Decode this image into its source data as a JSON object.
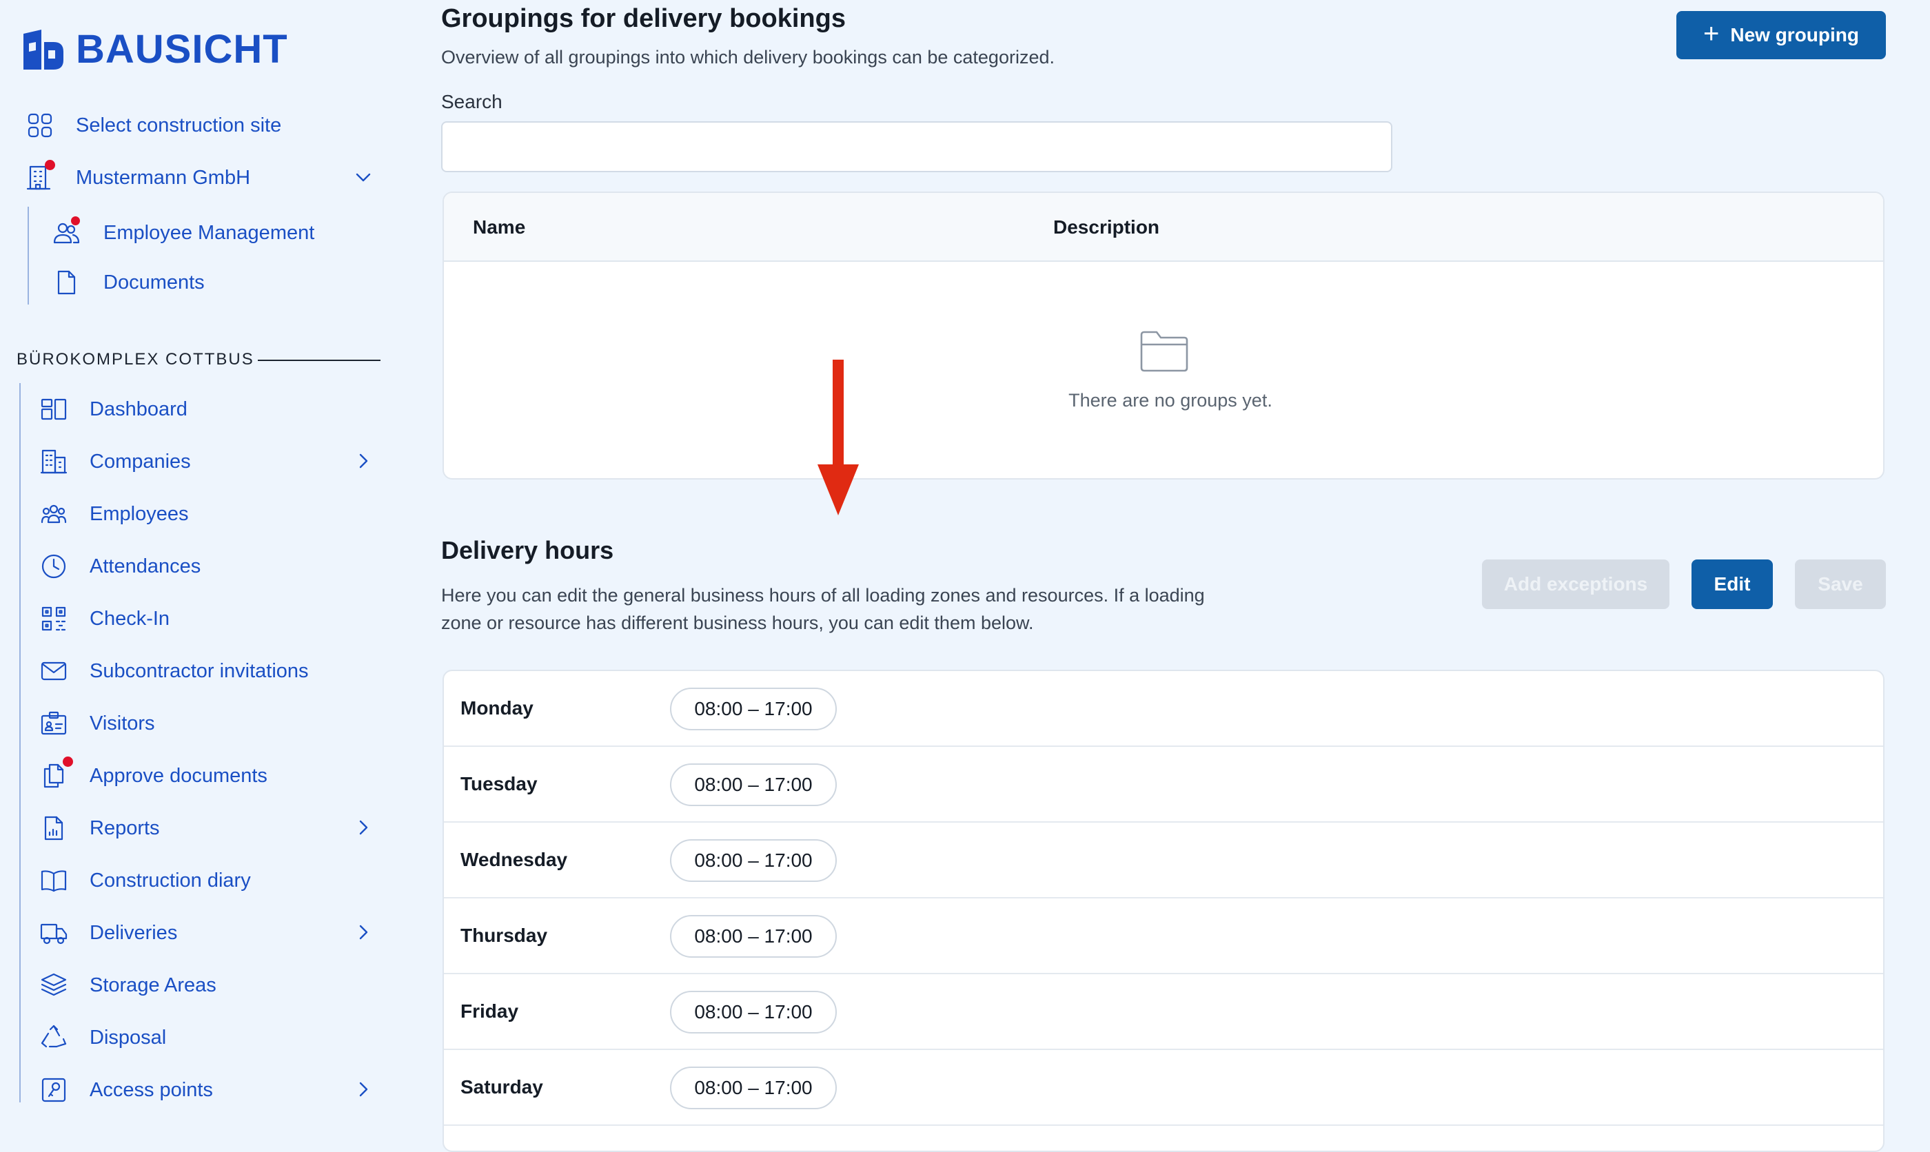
{
  "brand": {
    "name": "BAUSICHT"
  },
  "sidebar": {
    "top_items": [
      {
        "label": "Select construction site",
        "icon": "grid-icon"
      },
      {
        "label": "Mustermann GmbH",
        "icon": "building-icon"
      }
    ],
    "company_items": [
      {
        "label": "Employee Management",
        "icon": "users-icon"
      },
      {
        "label": "Documents",
        "icon": "document-icon"
      }
    ],
    "section_title": "BÜROKOMPLEX COTTBUS",
    "items": [
      {
        "label": "Dashboard",
        "icon": "dashboard-icon"
      },
      {
        "label": "Companies",
        "icon": "building-icon"
      },
      {
        "label": "Employees",
        "icon": "employees-icon"
      },
      {
        "label": "Attendances",
        "icon": "clock-icon"
      },
      {
        "label": "Check-In",
        "icon": "qr-code-icon"
      },
      {
        "label": "Subcontractor invitations",
        "icon": "mail-icon"
      },
      {
        "label": "Visitors",
        "icon": "id-badge-icon"
      },
      {
        "label": "Approve documents",
        "icon": "documents-icon"
      },
      {
        "label": "Reports",
        "icon": "report-icon"
      },
      {
        "label": "Construction diary",
        "icon": "book-icon"
      },
      {
        "label": "Deliveries",
        "icon": "truck-icon"
      },
      {
        "label": "Storage Areas",
        "icon": "layers-icon"
      },
      {
        "label": "Disposal",
        "icon": "recycle-icon"
      },
      {
        "label": "Access points",
        "icon": "access-icon"
      }
    ]
  },
  "groupings": {
    "title": "Groupings for delivery bookings",
    "subtitle": "Overview of all groupings into which delivery bookings can be categorized.",
    "new_button": "New grouping",
    "search_label": "Search",
    "search_value": "",
    "columns": {
      "name": "Name",
      "description": "Description"
    },
    "empty_text": "There are no groups yet."
  },
  "delivery_hours": {
    "title": "Delivery hours",
    "description": "Here you can edit the general business hours of all loading zones and resources. If a loading zone or resource has different business hours, you can edit them below.",
    "buttons": {
      "exceptions": "Add exceptions",
      "edit": "Edit",
      "save": "Save"
    },
    "days": [
      {
        "day": "Monday",
        "hours": "08:00 – 17:00"
      },
      {
        "day": "Tuesday",
        "hours": "08:00 – 17:00"
      },
      {
        "day": "Wednesday",
        "hours": "08:00 – 17:00"
      },
      {
        "day": "Thursday",
        "hours": "08:00 – 17:00"
      },
      {
        "day": "Friday",
        "hours": "08:00 – 17:00"
      },
      {
        "day": "Saturday",
        "hours": "08:00 – 17:00"
      }
    ]
  },
  "colors": {
    "brand": "#1a4fc4",
    "primary_button": "#0f5fa8",
    "notification_dot": "#e0102a",
    "annotation_arrow": "#e02a12",
    "disabled_button": "#d5dce5"
  }
}
